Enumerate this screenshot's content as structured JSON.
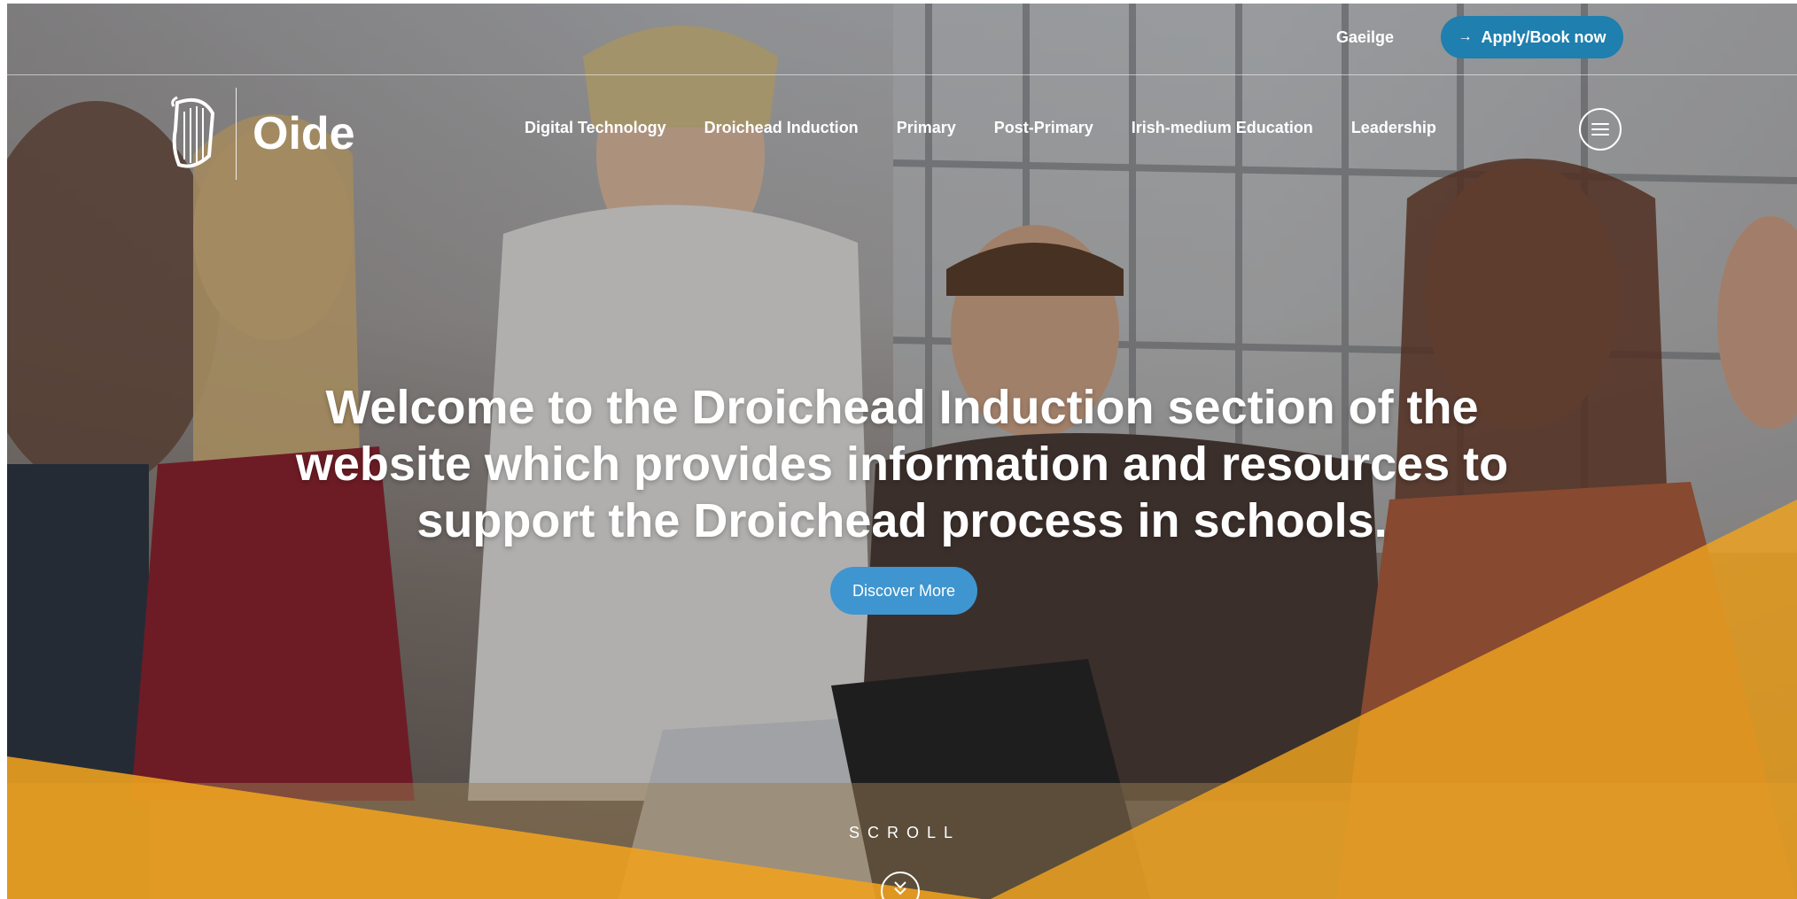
{
  "header": {
    "language_link": "Gaeilge",
    "apply_button": {
      "label": "Apply/Book now",
      "icon": "arrow-right-icon"
    },
    "logo_text": "Oide",
    "logo_icon": "harp-icon",
    "menu_icon": "hamburger-menu-icon"
  },
  "nav": {
    "items": [
      {
        "label": "Digital Technology"
      },
      {
        "label": "Droichead Induction"
      },
      {
        "label": "Primary"
      },
      {
        "label": "Post-Primary"
      },
      {
        "label": "Irish-medium Education"
      },
      {
        "label": "Leadership"
      }
    ]
  },
  "hero": {
    "headline": "Welcome to the Droichead Induction section of the website which provides information and resources to support the Droichead process in schools.",
    "cta_label": "Discover More",
    "scroll_label": "SCROLL",
    "scroll_icon": "double-chevron-down-icon"
  },
  "colors": {
    "accent_blue": "#1f7fae",
    "cta_blue": "#3f95cf",
    "brand_amber": "#f0a31f"
  }
}
